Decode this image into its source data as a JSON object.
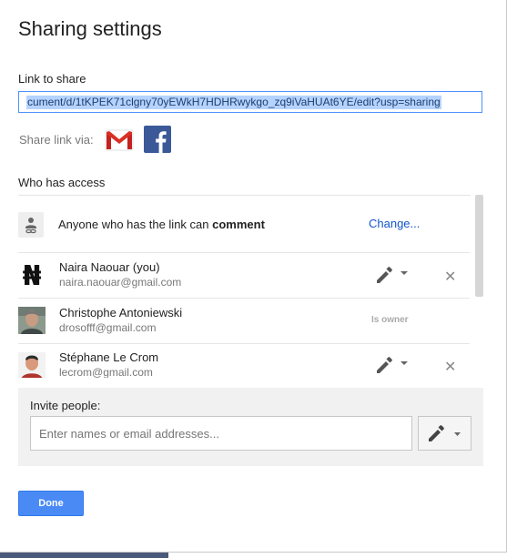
{
  "dialog": {
    "title": "Sharing settings"
  },
  "link": {
    "label": "Link to share",
    "value": "cument/d/1tKPEK71clgny70yEWkH7HDHRwykgo_zq9iVaHUAt6YE/edit?usp=sharing"
  },
  "share_via": {
    "label": "Share link via:",
    "icons": [
      "gmail-icon",
      "facebook-icon"
    ]
  },
  "access": {
    "label": "Who has access",
    "anyone": {
      "prefix": "Anyone who has the link can ",
      "role": "comment",
      "change_label": "Change..."
    },
    "users": [
      {
        "name": "Naira Naouar (you)",
        "email": "naira.naouar@gmail.com",
        "permission_icon": "pencil-icon",
        "removable": true
      },
      {
        "name": "Christophe Antoniewski",
        "email": "drosofff@gmail.com",
        "status": "Is owner"
      },
      {
        "name": "Stéphane Le Crom",
        "email": "lecrom@gmail.com",
        "permission_icon": "pencil-icon",
        "removable": true
      }
    ]
  },
  "invite": {
    "label": "Invite people:",
    "placeholder": "Enter names or email addresses..."
  },
  "done_label": "Done",
  "colors": {
    "accent": "#4a8af4",
    "link": "#1155cc",
    "selection": "#b6d3ff",
    "facebook": "#3b5998",
    "gmail_red": "#d93025"
  }
}
